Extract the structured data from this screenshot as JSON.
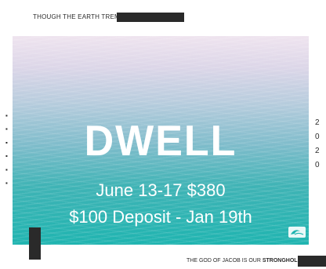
{
  "top_caption": "THOUGH THE EARTH TREMBLES",
  "hero": {
    "title": "DWELL",
    "line1": "June 13-17 $380",
    "line2": "$100 Deposit - Jan 19th"
  },
  "right_vertical_digits": [
    "2",
    "0",
    "2",
    "0"
  ],
  "bottom_caption": {
    "prefix": "THE GOD OF JACOB IS OUR ",
    "emphasis": "STRONGHOLD"
  },
  "colors": {
    "dark_accent": "#2a2a2a",
    "water_top": "#efe4ef",
    "water_bottom": "#1fb4b0"
  },
  "icons": [
    "wave-logo-icon"
  ]
}
